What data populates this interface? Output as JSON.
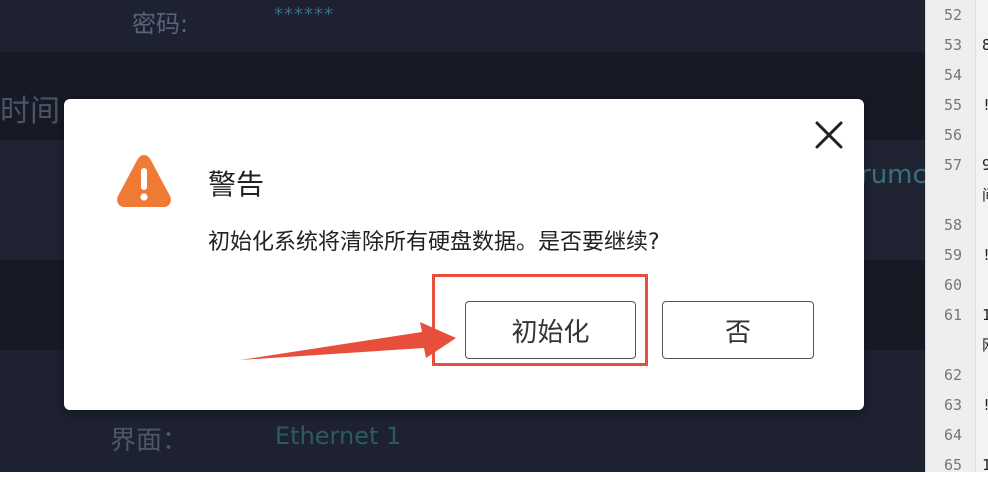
{
  "background": {
    "password_label": "密码:",
    "password_value": "******",
    "time_heading": "时间",
    "partial_text": "rumc",
    "interface_label": "界面：",
    "interface_value": "Ethernet 1"
  },
  "editor": {
    "lines": [
      {
        "num": "52",
        "text": ""
      },
      {
        "num": "53",
        "text": "8"
      },
      {
        "num": "54",
        "text": ""
      },
      {
        "num": "55",
        "text": "!"
      },
      {
        "num": "56",
        "text": ""
      },
      {
        "num": "57",
        "text": "9"
      },
      {
        "num": "",
        "text": "间"
      },
      {
        "num": "58",
        "text": ""
      },
      {
        "num": "59",
        "text": "!"
      },
      {
        "num": "60",
        "text": ""
      },
      {
        "num": "61",
        "text": "1"
      },
      {
        "num": "",
        "text": "网"
      },
      {
        "num": "62",
        "text": ""
      },
      {
        "num": "63",
        "text": "!"
      },
      {
        "num": "64",
        "text": ""
      },
      {
        "num": "65",
        "text": "1"
      }
    ]
  },
  "dialog": {
    "title": "警告",
    "message": "初始化系统将清除所有硬盘数据。是否要继续?",
    "confirm_label": "初始化",
    "cancel_label": "否",
    "close_icon": "close-icon",
    "warning_icon": "warning-icon"
  },
  "annotation": {
    "highlight_color": "#e84e3c",
    "arrow_color": "#e84e3c"
  },
  "colors": {
    "warning_orange": "#ef7a34",
    "background_dark": "#1b1f2b"
  }
}
